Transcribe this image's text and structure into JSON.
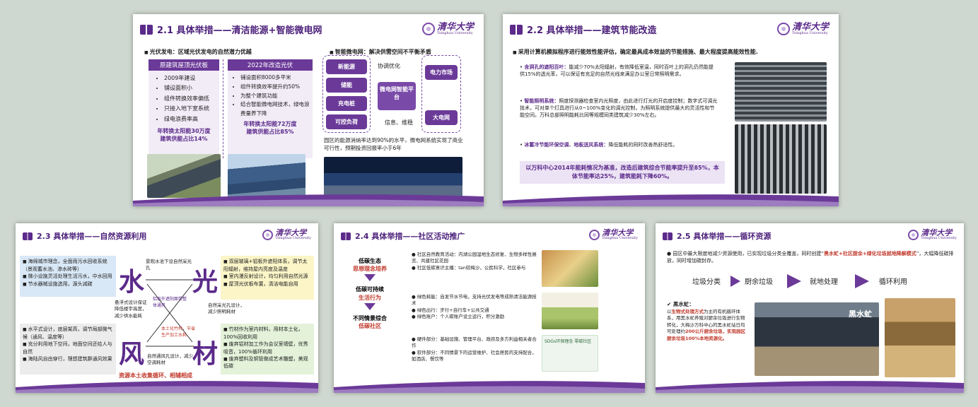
{
  "logo": {
    "text": "清华大学",
    "sub": "Tsinghua University"
  },
  "slide1": {
    "title": "2.1 具体举措——清洁能源+智能微电网",
    "pv_head": "光伏发电：区域光伏发电的自然潜力优越",
    "grid_head": "智能微电网：解决供需空间不平衡矛盾",
    "old_tag": "原建筑屋顶光伏板",
    "old_items": [
      "2009年建设",
      "铺设面积小",
      "组件转换效率偏低",
      "只接入地下室系统",
      "绿电浪费率高"
    ],
    "old_result1": "年转换太阳能30万度",
    "old_result2": "建筑供能占比14%",
    "new_tag": "2022年改造光伏",
    "new_items": [
      "铺设面积8000多平米",
      "组件转换效率提升约50%",
      "为整个建筑功能",
      "结合智能微电网技术，绿电浪费量养下降"
    ],
    "new_result1": "年转换太阳能72万度",
    "new_result2": "建筑供能占比85%",
    "left_pills": [
      "新能源",
      "储能",
      "充电桩",
      "可控负荷"
    ],
    "center_top": "协调优化",
    "center_box": "微电网智能平台",
    "center_bottom": "信息、维稳",
    "right_pills": [
      "电力市场",
      "大电网"
    ],
    "grid_desc": "园区的能源消纳率达到90%的水平，微电网系统实现了商业可行性，预期投资回报率小于6年"
  },
  "slide2": {
    "title": "2.2 具体举措——建筑节能改造",
    "intro": "采用计算机模拟程序进行能效性能评估，确定最具成本效益的节能措施、最大程度提高能效性能.",
    "b1_lead": "含洞孔的遮阳百叶：",
    "b1": "能减少70%太阳辐射，有效降低室温，同时百叶上的洞孔仍然能提供15%的透光率，可以保证有充足的自然光线来满足办公室日常照明需求。",
    "b2_lead": "智能照明系统：",
    "b2": "照度探测器检查室内光照度，由此进行灯光的开启度控制；数字式可调光技术，可对单个灯具进行从0~100%变化的调光控制，为照明系统提供最大的灵活性和节能空间。万科总部照明能耗比同等规模同类建筑减少30%左右。",
    "b3_lead": "冰蓄冷节能环保空调、地板送风系统：",
    "b3": "降低能耗的同时改善热舒适性。",
    "highlight": "以万科中心2014年能耗情况为基准，改造后建筑综合节能率提升至85%，本体节能率达25%，建筑能耗下降60%。"
  },
  "slide3": {
    "title": "2.3 具体举措——自然资源利用",
    "chars": [
      "水",
      "光",
      "风",
      "材"
    ],
    "tl": [
      "海绵城市理念，全面雨污水回收系统（景观蓄水池、渗水砖等）",
      "微小设施灵活处理生活污水，中水回用",
      "节水器械设施选用，源头减碳"
    ],
    "tr": [
      "双层玻璃+铝板外遮阳体系，调节太阳辐射，维持屋内亮度及温度",
      "室内漫反射设计，均匀利用自然光源",
      "屋顶光伏板布置，清洁电能自用"
    ],
    "bl": [
      "水平式设计，底层架高，调节局部微气候（通风、温度等）",
      "充分利用地下空间，地面空间还给人与自然",
      "海陆风自由穿行，理想建筑群通风效果"
    ],
    "br": [
      "竹材作为室内材料，用材本土化，100%回收利用",
      "废弃铝材加工作为会议室墙壁，优秀吸音，100%循环利用",
      "废弃塑料及铜管做成艺术雕塑，美观低碳"
    ],
    "t_mid": "景观水池下设自然采光孔",
    "l_mid": "悬浮式设计保证降低楼宇高度，减少供水能耗",
    "r_mid": "自然采光孔设计，减少照明耗材",
    "b_mid": "自然通风孔设计，减少空调耗材",
    "c1": "铝板外遮阳面带整体通风",
    "c2": "本土化竹材，节省生产加工水耗",
    "bottom": "资源本土收集循环、相辅相成"
  },
  "slide4": {
    "title": "2.4 具体举措——社区活动推广",
    "flow": [
      "低碳生态",
      "思想理念培养",
      "低碳可持续",
      "生活行为",
      "不同情景综合",
      "低碳社区"
    ],
    "p1": [
      "社区自然教育活动：内湖公园湿地生态修复、生物多样性展览、共建社区花园",
      "社区低碳意识主播：tan较梅沙，公民科学，社区参与"
    ],
    "p2": [
      "绿色耗能：自发节水节电，支持光伏发电等成熟清洁能源技术",
      "绿色出行：步行+自行车+公共交通",
      "绿色账户：个人碳账户设立运行，积分激励"
    ],
    "p3": [
      "硬件部分：基础设施、管理平台、政府及多方利益相关者合作",
      "软件部分：不同情景下的运营维护、社会居民的支持配合，如酒店、餐饮等"
    ],
    "img_caption": "SDGs环保理念 零碳社区"
  },
  "slide5": {
    "title": "2.5 具体举措——循环资源",
    "intro_a": "园区中最大限度地减少资源使用，已实现垃圾分类全覆盖，同时创建“",
    "intro_red": "黑水虻+社区厨余+绿化垃圾就地降解模式",
    "intro_b": "”，大幅降低碳排放，同时增加碳封存。",
    "steps": [
      "垃圾分类",
      "厨余垃圾",
      "就地处理",
      "循环利用"
    ],
    "bsf_head": "黑水虻：",
    "bsf_a": "以",
    "bsf_red1": "生物式处理方式",
    "bsf_b": "为主的有机循环体系，用黑水虻养殖对厨余垃圾进行生物转化，大梅沙万科中心的黑水虻站日均可处理约",
    "bsf_red2": "200公斤厨余垃圾，实现园区厨余垃圾100%本地资源化。",
    "poster": "黑水虻"
  }
}
